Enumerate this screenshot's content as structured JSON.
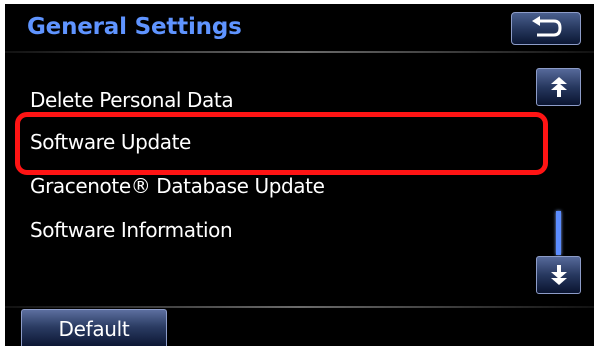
{
  "header": {
    "title": "General Settings"
  },
  "back_button": {
    "icon": "return-arrow-icon"
  },
  "menu": {
    "items": [
      {
        "label": "Delete Personal Data"
      },
      {
        "label": "Software Update"
      },
      {
        "label": "Gracenote® Database Update"
      },
      {
        "label": "Software Information"
      }
    ],
    "highlighted_index": 1,
    "highlight_color": "#ff1414"
  },
  "scroll": {
    "up_icon": "page-up-arrow-icon",
    "down_icon": "page-down-arrow-icon"
  },
  "footer": {
    "default_label": "Default"
  },
  "colors": {
    "title": "#5f94ff",
    "background": "#000000",
    "text": "#ffffff"
  }
}
